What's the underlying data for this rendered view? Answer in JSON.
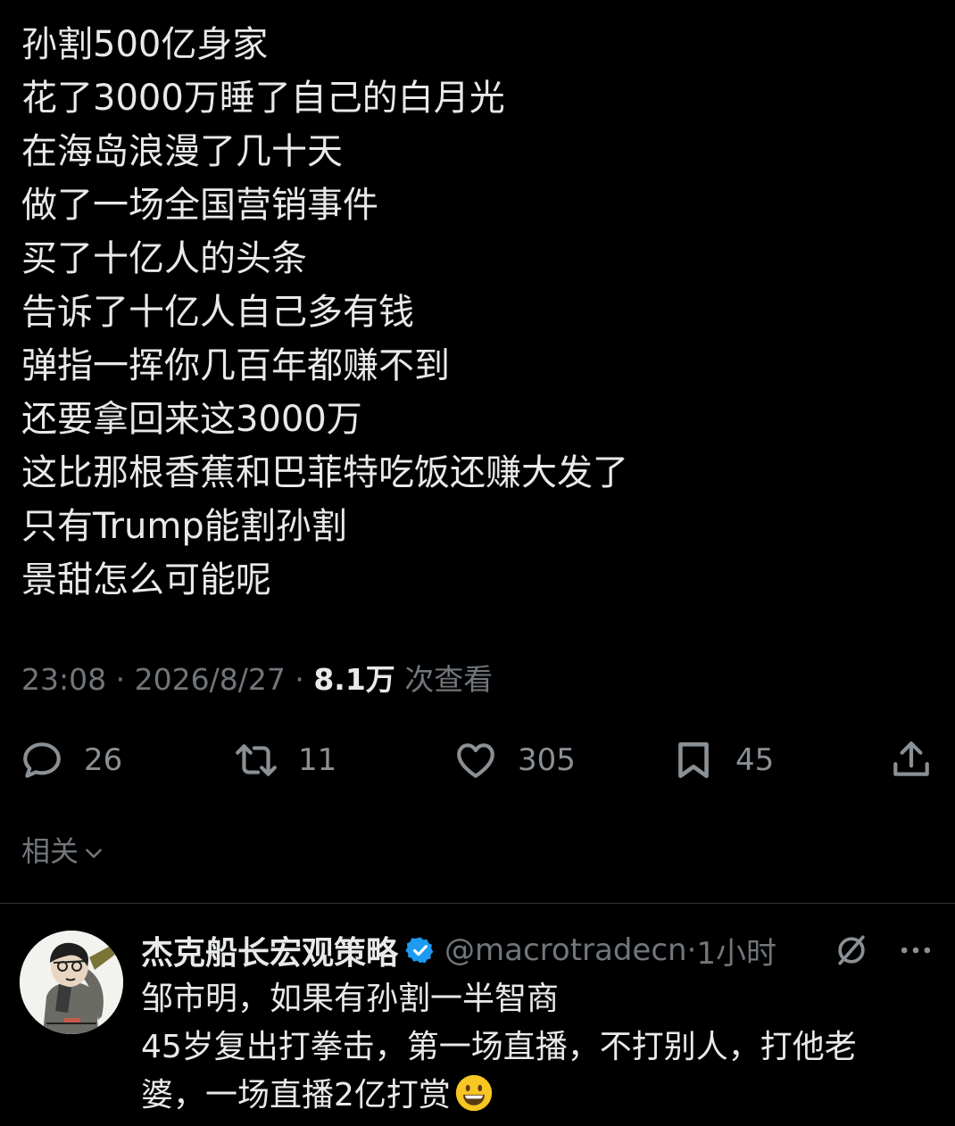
{
  "post": {
    "lines": [
      "孙割500亿身家",
      "花了3000万睡了自己的白月光",
      "在海岛浪漫了几十天",
      "做了一场全国营销事件",
      "买了十亿人的头条",
      "告诉了十亿人自己多有钱",
      "弹指一挥你几百年都赚不到",
      "还要拿回来这3000万",
      "这比那根香蕉和巴菲特吃饭还赚大发了",
      "只有Trump能割孙割",
      "景甜怎么可能呢"
    ],
    "time": "23:08",
    "date": "2026/8/27",
    "separator": "·",
    "views": "8.1万",
    "views_label": "次查看"
  },
  "actions": {
    "reply_count": "26",
    "repost_count": "11",
    "like_count": "305",
    "bookmark_count": "45",
    "icons": [
      "reply-icon",
      "repost-icon",
      "like-icon",
      "bookmark-icon",
      "share-icon"
    ]
  },
  "related": {
    "label": "相关"
  },
  "reply": {
    "name": "杰克船长宏观策略",
    "handle": "@macrotradecn",
    "separator": "·",
    "time": "1小时",
    "lines": [
      "邹市明，如果有孙割一半智商",
      "45岁复出打拳击，第一场直播，不打别人，打他老",
      "婆，一场直播2亿打赏"
    ],
    "emoji": "smiley-emoji"
  },
  "colors": {
    "background": "#000000",
    "text": "#e7e9ea",
    "secondary": "#71767b",
    "verified": "#1d9bf0",
    "divider": "#2f3336"
  }
}
